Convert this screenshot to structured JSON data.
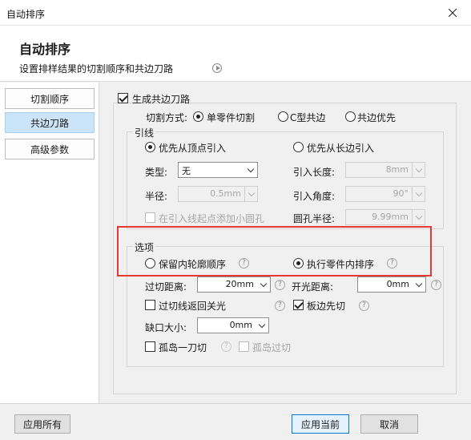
{
  "window": {
    "title": "自动排序"
  },
  "header": {
    "title": "自动排序",
    "subtitle": "设置排样结果的切割顺序和共边刀路"
  },
  "sidebar": {
    "items": [
      {
        "label": "切割顺序"
      },
      {
        "label": "共边刀路"
      },
      {
        "label": "高级参数"
      }
    ]
  },
  "form": {
    "generate_common_edge": "生成共边刀路",
    "cut_mode_label": "切割方式:",
    "cut_modes": [
      "单零件切割",
      "C型共边",
      "共边优先"
    ],
    "lead": {
      "group": "引线",
      "vertex_first": "优先从顶点引入",
      "long_edge_first": "优先从长边引入",
      "type_label": "类型:",
      "type_value": "无",
      "radius_label": "半径:",
      "radius_value": "0.5mm",
      "add_circle": "在引入线起点添加小圆孔",
      "lead_length_label": "引入长度:",
      "lead_length_value": "8mm",
      "lead_angle_label": "引入角度:",
      "lead_angle_value": "90°",
      "hole_radius_label": "圆孔半径:",
      "hole_radius_value": "9.99mm"
    },
    "options": {
      "group": "选项",
      "keep_inner": "保留内轮廓顺序",
      "exec_inner": "执行零件内排序",
      "overcut_label": "过切距离:",
      "overcut_value": "20mm",
      "open_label": "开光距离:",
      "open_value": "0mm",
      "overcut_return": "过切线返回关光",
      "edge_first": "板边先切",
      "gap_label": "缺口大小:",
      "gap_value": "0mm",
      "island_one_cut": "孤岛一刀切",
      "island_cut": "孤岛过切"
    }
  },
  "footer": {
    "apply_all": "应用所有",
    "apply_current": "应用当前",
    "cancel": "取消"
  },
  "colors": {
    "highlight": "#e53935",
    "active_tab": "#cce4f7",
    "primary_border": "#0078d7"
  }
}
